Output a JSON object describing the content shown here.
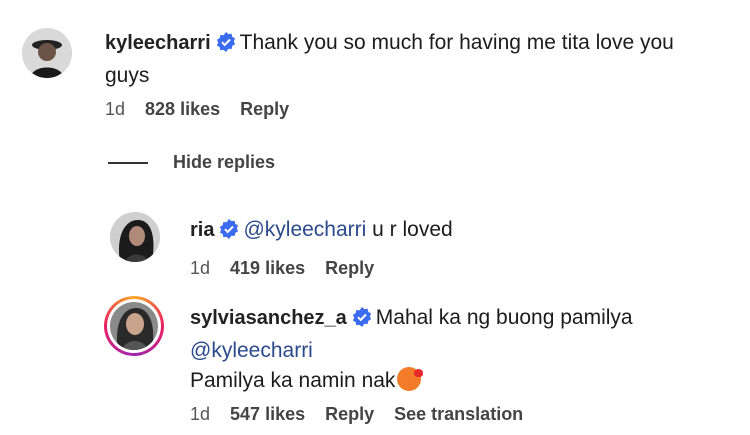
{
  "comments": [
    {
      "username": "kyleecharri",
      "verified": true,
      "text_line1": "Thank you so much for having me tita love you",
      "text_line2": "guys",
      "time": "1d",
      "likes": "828 likes",
      "reply": "Reply"
    }
  ],
  "hide_replies_label": "Hide replies",
  "replies": [
    {
      "username": "ria",
      "verified": true,
      "mention": "@kyleecharri",
      "text": "u r loved",
      "time": "1d",
      "likes": "419 likes",
      "reply": "Reply"
    },
    {
      "username": "sylviasanchez_a",
      "verified": true,
      "text_line1": "Mahal ka ng buong pamilya",
      "mention": "@kyleecharri",
      "text_line3": "Pamilya ka namin nak",
      "emoji": "kissing-heart-emoji",
      "time": "1d",
      "likes": "547 likes",
      "reply": "Reply",
      "see_translation": "See translation"
    }
  ],
  "colors": {
    "verified_blue": "#3b6cf0",
    "story_ring": [
      "#f9a825",
      "#e91e63",
      "#9c27b0"
    ]
  }
}
